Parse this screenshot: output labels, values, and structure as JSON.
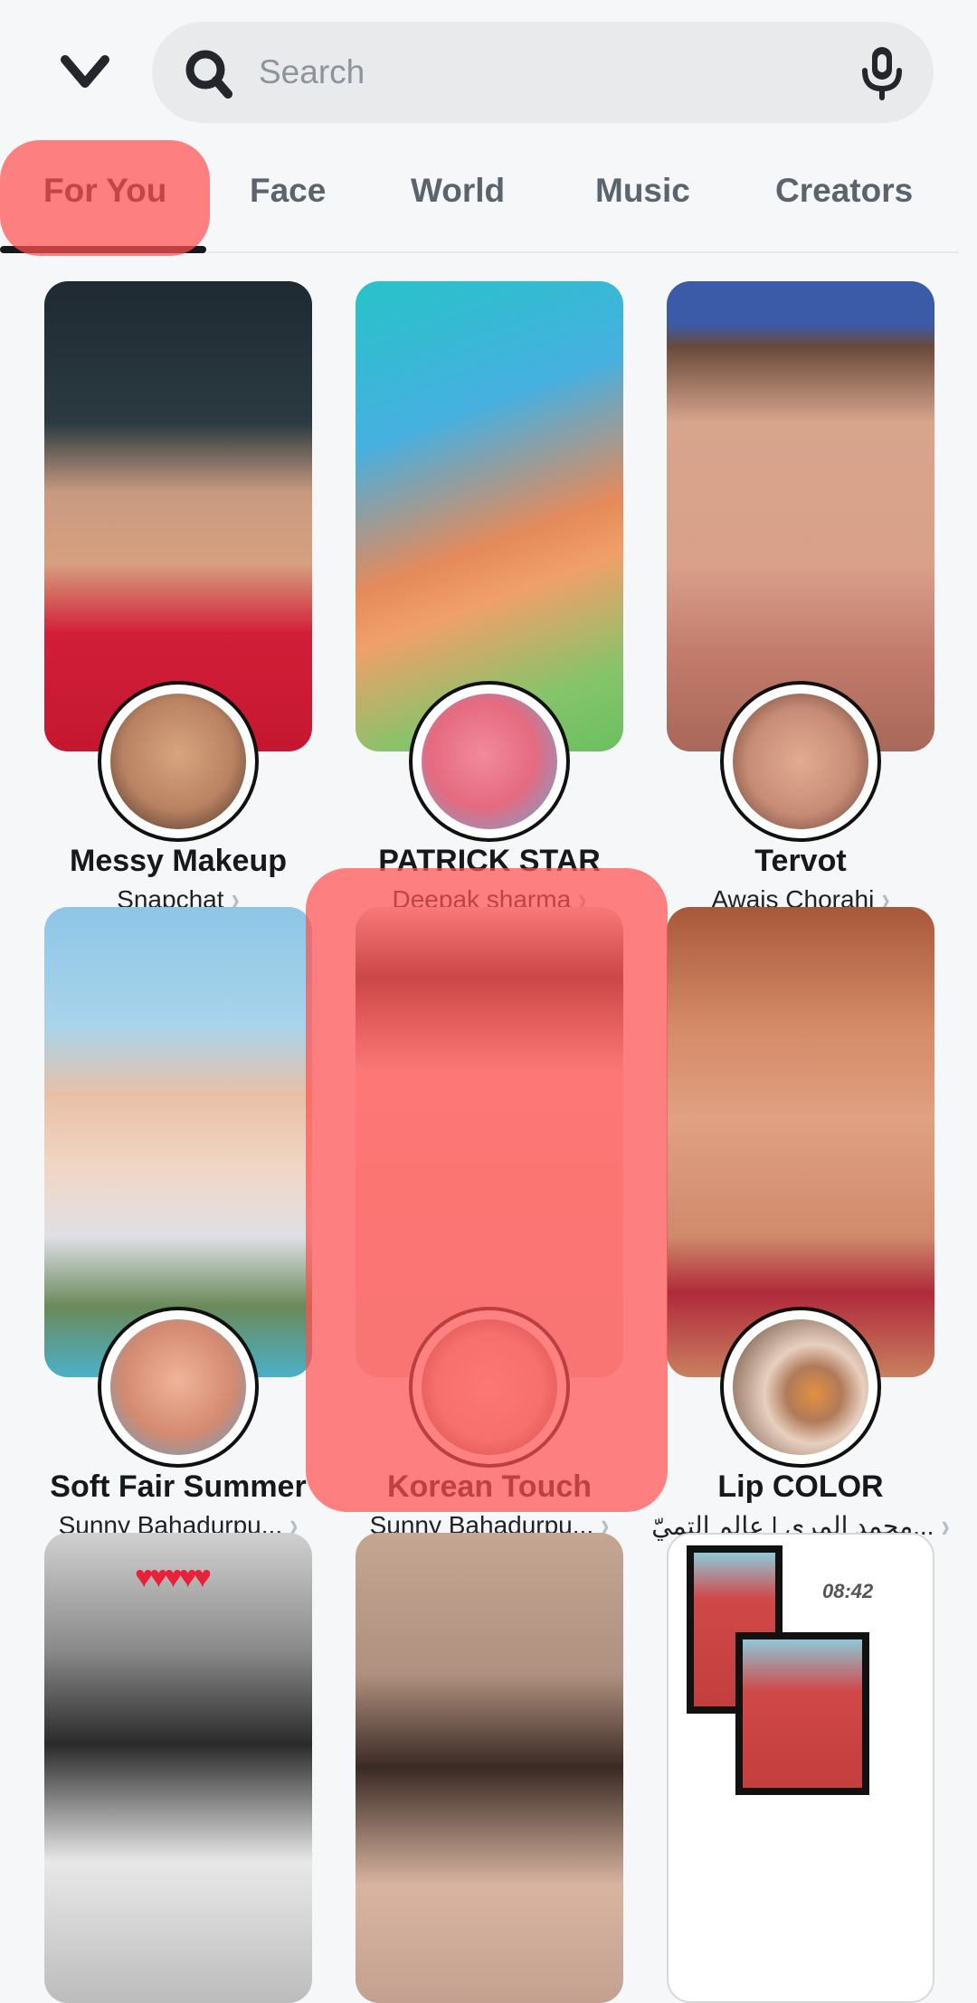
{
  "header": {
    "back_icon": "chevron-down-icon",
    "search": {
      "placeholder": "Search",
      "value": "",
      "icon": "search-icon",
      "mic_icon": "microphone-icon"
    }
  },
  "tabs": [
    {
      "label": "For You",
      "active": true
    },
    {
      "label": "Face",
      "active": false
    },
    {
      "label": "World",
      "active": false
    },
    {
      "label": "Music",
      "active": false
    },
    {
      "label": "Creators",
      "active": false
    }
  ],
  "lenses": [
    {
      "title": "Messy Makeup",
      "creator": "Snapchat"
    },
    {
      "title": "PATRICK STAR",
      "creator": "Deepak sharma"
    },
    {
      "title": "Tervot",
      "creator": "Awais Chorahi"
    },
    {
      "title": "Soft Fair Summer",
      "creator": "Sunny Bahadurpu..."
    },
    {
      "title": "Korean Touch",
      "creator": "Sunny Bahadurpu..."
    },
    {
      "title": "Lip COLOR",
      "creator": "محمد المري | عالم التميّ..."
    },
    {
      "title": "",
      "creator": ""
    },
    {
      "title": "",
      "creator": ""
    },
    {
      "title": "",
      "creator": "",
      "overlay_text": "08:42"
    }
  ],
  "highlight_color": "#ff5050"
}
